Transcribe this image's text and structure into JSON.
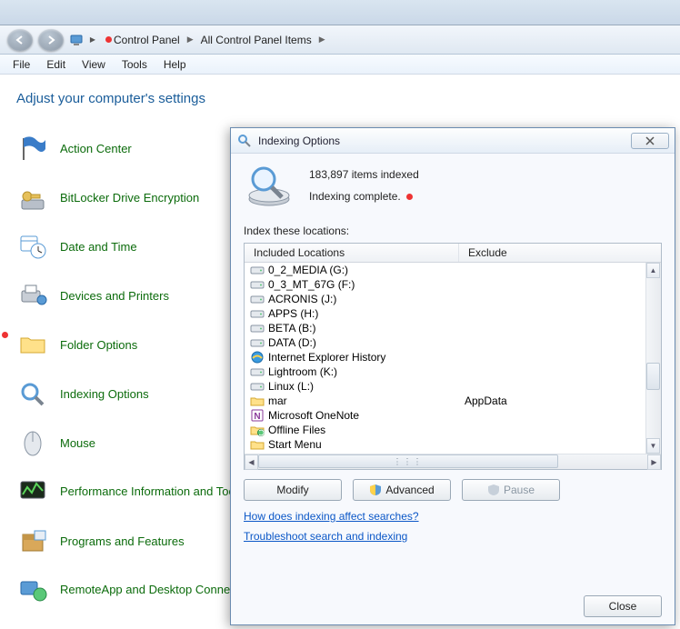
{
  "breadcrumb": {
    "root_tooltip": "Computer",
    "item1": "Control Panel",
    "item2": "All Control Panel Items"
  },
  "menubar": {
    "file": "File",
    "edit": "Edit",
    "view": "View",
    "tools": "Tools",
    "help": "Help"
  },
  "page": {
    "title": "Adjust your computer's settings"
  },
  "cpl_items": [
    {
      "label": "Action Center"
    },
    {
      "label": "BitLocker Drive Encryption"
    },
    {
      "label": "Date and Time"
    },
    {
      "label": "Devices and Printers"
    },
    {
      "label": "Folder Options"
    },
    {
      "label": "Indexing Options"
    },
    {
      "label": "Mouse"
    },
    {
      "label": "Performance Information and Tools"
    },
    {
      "label": "Programs and Features"
    },
    {
      "label": "RemoteApp and Desktop Connections"
    }
  ],
  "dialog": {
    "title": "Indexing Options",
    "status_count": "183,897 items indexed",
    "status_text": "Indexing complete.",
    "locations_label": "Index these locations:",
    "col_included": "Included Locations",
    "col_exclude": "Exclude",
    "rows": [
      {
        "icon": "drive",
        "inc": "0_2_MEDIA (G:)",
        "exc": ""
      },
      {
        "icon": "drive",
        "inc": "0_3_MT_67G (F:)",
        "exc": ""
      },
      {
        "icon": "drive",
        "inc": "ACRONIS (J:)",
        "exc": ""
      },
      {
        "icon": "drive",
        "inc": "APPS (H:)",
        "exc": ""
      },
      {
        "icon": "drive",
        "inc": "BETA (B:)",
        "exc": ""
      },
      {
        "icon": "drive",
        "inc": "DATA (D:)",
        "exc": ""
      },
      {
        "icon": "ie",
        "inc": "Internet Explorer History",
        "exc": ""
      },
      {
        "icon": "drive",
        "inc": "Lightroom (K:)",
        "exc": ""
      },
      {
        "icon": "drive",
        "inc": "Linux (L:)",
        "exc": ""
      },
      {
        "icon": "folder",
        "inc": "mar",
        "exc": "AppData"
      },
      {
        "icon": "note",
        "inc": "Microsoft OneNote",
        "exc": ""
      },
      {
        "icon": "off",
        "inc": "Offline Files",
        "exc": ""
      },
      {
        "icon": "folder",
        "inc": "Start Menu",
        "exc": ""
      }
    ],
    "btn_modify": "Modify",
    "btn_advanced": "Advanced",
    "btn_pause": "Pause",
    "link_how": "How does indexing affect searches?",
    "link_troubleshoot": "Troubleshoot search and indexing",
    "btn_close": "Close"
  }
}
